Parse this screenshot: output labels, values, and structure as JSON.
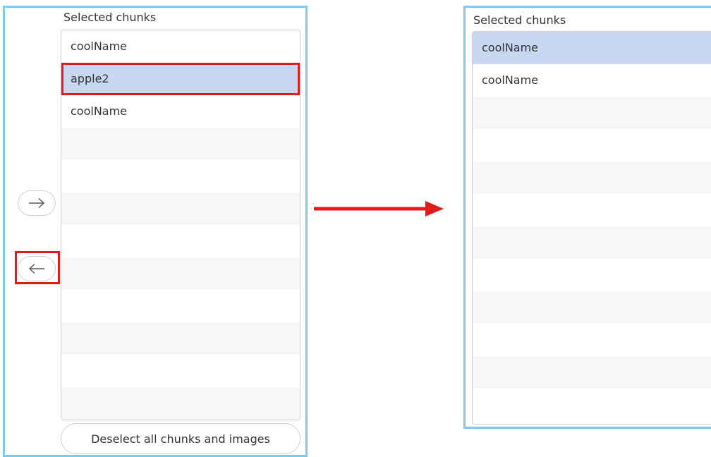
{
  "left_panel": {
    "title": "Selected chunks",
    "items": [
      {
        "label": "coolName",
        "selected": false
      },
      {
        "label": "apple2",
        "selected": true
      },
      {
        "label": "coolName",
        "selected": false
      }
    ],
    "move_right_icon": "arrow-right-icon",
    "move_left_icon": "arrow-left-icon",
    "deselect_label": "Deselect all chunks and images"
  },
  "right_panel": {
    "title": "Selected chunks",
    "items": [
      {
        "label": "coolName",
        "selected": true
      },
      {
        "label": "coolName",
        "selected": false
      }
    ]
  },
  "transition_icon": "arrow-right-icon",
  "colors": {
    "frame_border": "#7cc9e8",
    "selection": "#c8d8f1",
    "annotation_red": "#e01b1b"
  }
}
